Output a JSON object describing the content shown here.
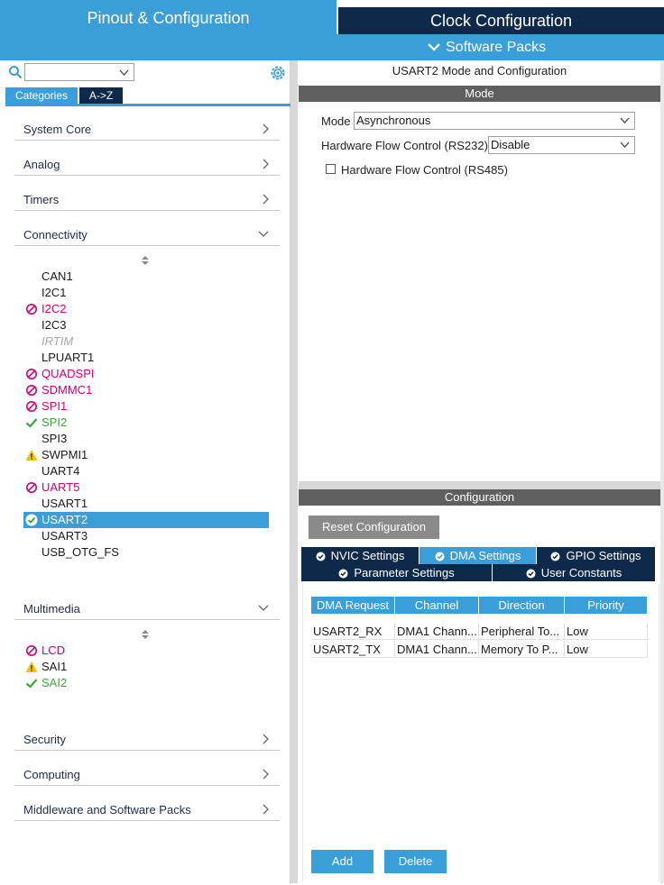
{
  "tabs": {
    "pinout": "Pinout & Configuration",
    "clock": "Clock Configuration",
    "software_packs": "Software Packs"
  },
  "left": {
    "search_value": "",
    "tab_categories": "Categories",
    "tab_az": "A->Z",
    "categories": {
      "system_core": "System Core",
      "analog": "Analog",
      "timers": "Timers",
      "connectivity": "Connectivity",
      "multimedia": "Multimedia",
      "security": "Security",
      "computing": "Computing",
      "middleware": "Middleware and Software Packs"
    },
    "connectivity_items": [
      {
        "label": "CAN1",
        "status": "none"
      },
      {
        "label": "I2C1",
        "status": "none"
      },
      {
        "label": "I2C2",
        "status": "blocked"
      },
      {
        "label": "I2C3",
        "status": "none"
      },
      {
        "label": "IRTIM",
        "status": "disabled"
      },
      {
        "label": "LPUART1",
        "status": "none"
      },
      {
        "label": "QUADSPI",
        "status": "blocked"
      },
      {
        "label": "SDMMC1",
        "status": "blocked"
      },
      {
        "label": "SPI1",
        "status": "blocked"
      },
      {
        "label": "SPI2",
        "status": "ok"
      },
      {
        "label": "SPI3",
        "status": "none"
      },
      {
        "label": "SWPMI1",
        "status": "warning"
      },
      {
        "label": "UART4",
        "status": "none"
      },
      {
        "label": "UART5",
        "status": "blocked"
      },
      {
        "label": "USART1",
        "status": "none"
      },
      {
        "label": "USART2",
        "status": "selected"
      },
      {
        "label": "USART3",
        "status": "none"
      },
      {
        "label": "USB_OTG_FS",
        "status": "none"
      }
    ],
    "multimedia_items": [
      {
        "label": "LCD",
        "status": "blocked"
      },
      {
        "label": "SAI1",
        "status": "warning"
      },
      {
        "label": "SAI2",
        "status": "ok"
      }
    ]
  },
  "mode": {
    "title": "USART2 Mode and Configuration",
    "header": "Mode",
    "mode_label": "Mode",
    "mode_value": "Asynchronous",
    "hfc_label": "Hardware Flow Control (RS232)",
    "hfc_value": "Disable",
    "rs485_label": "Hardware Flow Control (RS485)",
    "rs485_checked": false
  },
  "config": {
    "header": "Configuration",
    "reset_label": "Reset Configuration",
    "tabs": {
      "nvic": "NVIC Settings",
      "dma": "DMA Settings",
      "gpio": "GPIO Settings",
      "param": "Parameter Settings",
      "user": "User Constants"
    },
    "columns": [
      "DMA Request",
      "Channel",
      "Direction",
      "Priority"
    ],
    "rows": [
      [
        "USART2_RX",
        "DMA1 Chann...",
        "Peripheral To...",
        "Low"
      ],
      [
        "USART2_TX",
        "DMA1 Chann...",
        "Memory To P...",
        "Low"
      ]
    ],
    "add_label": "Add",
    "delete_label": "Delete"
  },
  "colors": {
    "accent": "#3a9fd9",
    "dark": "#0e2a4a",
    "blocked": "#d4006e",
    "ok": "#3aa83a",
    "warning": "#f2c200"
  }
}
